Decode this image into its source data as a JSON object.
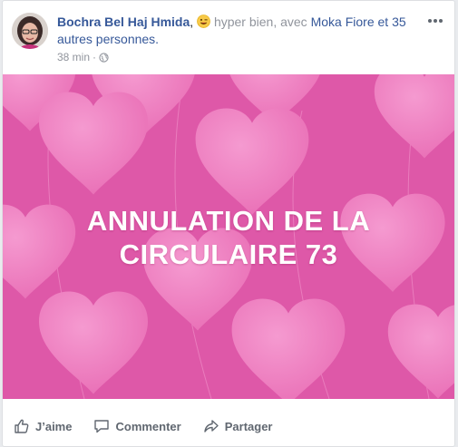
{
  "post": {
    "author": "Bochra Bel Haj Hmida",
    "separator": ",",
    "feeling": "hyper bien",
    "with_prefix": ", avec",
    "tagged_person": "Moka Fiore",
    "others_text": "et 35 autres personnes.",
    "timestamp": "38 min",
    "dot": "·",
    "privacy_icon": "globe-icon",
    "feeling_icon": "winking-face-icon",
    "more_icon": "more-options-icon"
  },
  "image": {
    "line1": "ANNULATION DE LA",
    "line2": "CIRCULAIRE 73",
    "background_color": "#e05aa9",
    "heart_color": "#ee7fc0"
  },
  "actions": {
    "like": "J’aime",
    "comment": "Commenter",
    "share": "Partager"
  },
  "colors": {
    "link": "#365899",
    "muted": "#90949c",
    "action_text": "#606770"
  }
}
